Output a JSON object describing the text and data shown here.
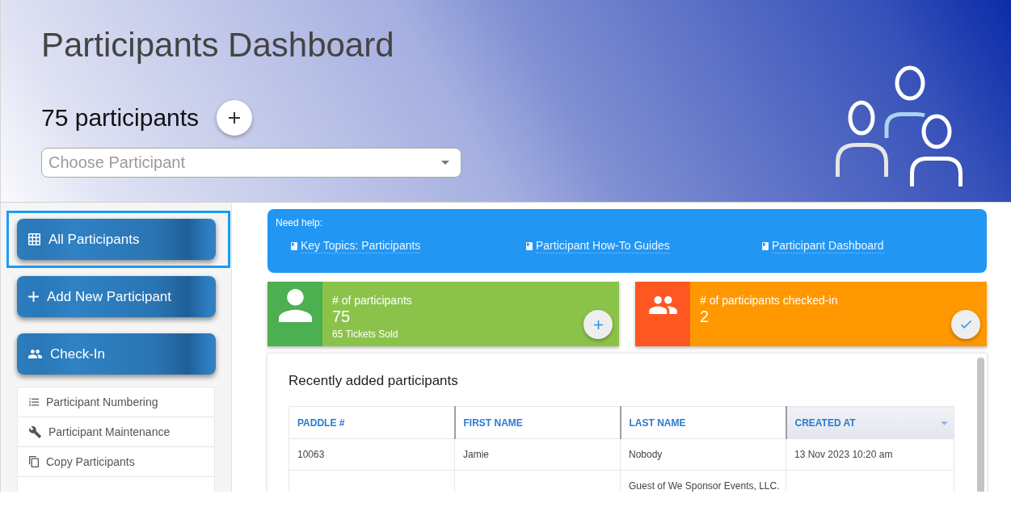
{
  "header": {
    "title": "Participants Dashboard",
    "count": "75 participants",
    "search": {
      "placeholder": "Choose Participant"
    }
  },
  "sidebar": {
    "buttons": [
      {
        "label": "All Participants",
        "selected": true
      },
      {
        "label": "Add New Participant",
        "selected": false
      },
      {
        "label": "Check-In",
        "selected": false
      }
    ],
    "menu": [
      {
        "label": "Participant Numbering"
      },
      {
        "label": "Participant Maintenance"
      },
      {
        "label": "Copy Participants"
      }
    ]
  },
  "help": {
    "label": "Need help:",
    "links": [
      "Key Topics: Participants",
      "Participant How-To Guides",
      "Participant Dashboard"
    ]
  },
  "stats": [
    {
      "kind": "total",
      "title": "# of participants",
      "value": "75",
      "note": "65 Tickets Sold",
      "color": "#8bc34a",
      "accent": {
        "color": "#4caf50"
      }
    },
    {
      "kind": "checkin",
      "title": "# of participants checked-in",
      "value": "2",
      "color": "#ff9800",
      "accent": {
        "color": "#ff5722"
      }
    }
  ],
  "recent": {
    "title": "Recently added participants",
    "columns": [
      {
        "label": "PADDLE #",
        "sorted": false
      },
      {
        "label": "FIRST NAME",
        "sorted": false
      },
      {
        "label": "LAST NAME",
        "sorted": false
      },
      {
        "label": "CREATED AT",
        "sorted": true
      }
    ],
    "rows": [
      {
        "paddle": "10063",
        "first_name": "Jamie",
        "last_name": "Nobody",
        "created_at": "13 Nov 2023 10:20 am"
      },
      {
        "last_name": "Guest of We Sponsor Events, LLC."
      }
    ]
  }
}
